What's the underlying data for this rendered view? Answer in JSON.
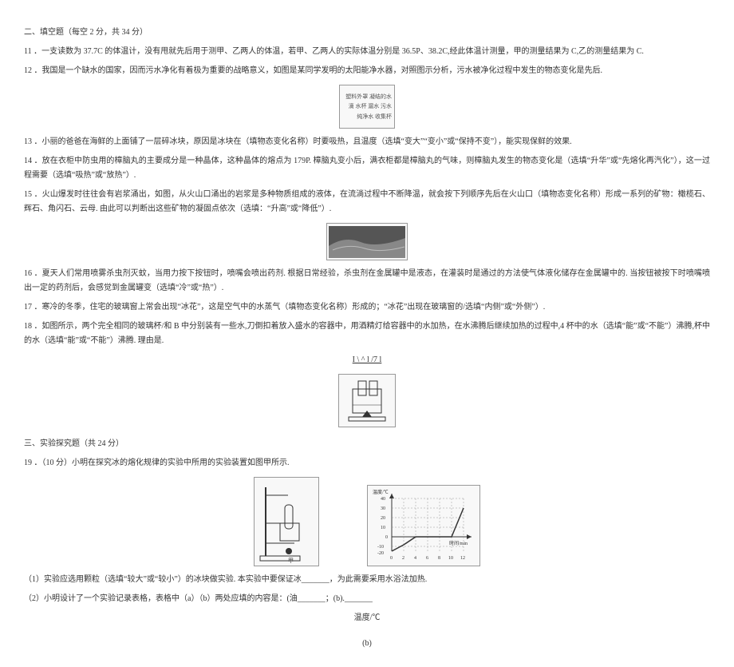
{
  "section2": {
    "header": "二、填空题（每空 2 分，共 34 分）",
    "q11": "11 ．一支读数为 37.7C 的体温计，没有甩就先后用于测甲、乙两人的体温，若甲、乙两人的实际体温分别是 36.5P、38.2C,经此体温计测量，甲的测量结果为 C,乙的测量结果为 C.",
    "q12": "12 ．我国是一个缺水的国家，因而污水净化有着极为重要的战略意义，如图是某同学发明的太阳能净水器，对照图示分析，污水被净化过程中发生的物态变化是先后.",
    "purifier_labels": "塑料外罩\n凝结的水滴\n水杯 漏水\n污水 纯净水\n收集杯",
    "q13": "13 ．小丽的爸爸在海鲜的上面铺了一层碎冰块，原因是冰块在（填物态变化名称）时要吸热，且温度（选填“变大”“变小”或“保持不变”），能实现保鲜的效果.",
    "q14": "14 ．放在衣柜中防虫用的樟脑丸的主要成分是一种晶体，这种晶体的熔点为 179P. 樟脑丸变小后，满衣柜都是樟脑丸的气味，则樟脑丸发生的物态变化是（选填“升华”或“先熔化再汽化”），这一过程需要（选填“吸热”或“放热”）.",
    "q15": "15 ．火山爆发时往往会有岩浆涌出，如图，从火山口涌出的岩浆是多种物质组成的液体，在流淌过程中不断降温，就会按下列顺序先后在火山口（填物态变化名称）形成一系列的矿物：橄榄石、辉石、角闪石、云母. 由此可以判断出这些矿物的凝固点依次（选填：“升高”或“降低”）.",
    "q16": "16 ．夏天人们常用喷雾杀虫剂灭蚊，当用力按下按钮时，喷嘴会喷出药剂. 根据日常经验，杀虫剂在金属罐中是液态，在灌装时是通过的方法使气体液化储存在金属罐中的. 当按钮被按下时喷嘴喷出一定的药剂后，会感觉到金属罐变（选填“冷”或“热”）.",
    "q17": "17 ．寒冷的冬季，住宅的玻璃窗上常会出现“冰花”，这是空气中的水蒸气（填物态变化名称）形成的；“冰花”出现在玻璃窗的/选填“内侧”或“外侧”）.",
    "q18": "18 ．如图所示，两个完全相同的玻璃杯/和 B 中分别装有一些水,刀倒扣着放入盛水的容器中，用酒精灯给容器中的水加热，在水沸腾后继续加热的过程中,4 杯中的水（选填“能”或“不能”）沸腾,杯中的水（选填“能”或“不能”）沸腾. 理由是.",
    "formula": "I \\ ^ l /7 l"
  },
  "section3": {
    "header": "三、实验探究题（共 24 分）",
    "q19_intro": "19 ．（10 分）小明在探究冰的熔化规律的实验中所用的实验装置如图甲所示.",
    "sub1": "（1）实验应选用颗粒（选填“较大”或“较小”）的冰块做实验. 本实验中要保证冰_______，为此需要采用水浴法加热.",
    "sub2": "（2）小明设计了一个实验记录表格，表格中（a）（b）两处应填的内容是：(油_______；(b)._______",
    "table_a": "温度/℃",
    "table_b": "(b)",
    "chart_data": {
      "type": "line",
      "title": "",
      "xlabel": "时间/min",
      "ylabel": "温度/℃",
      "x": [
        0,
        2,
        4,
        6,
        8,
        10,
        12
      ],
      "y": [
        -20,
        -10,
        0,
        0,
        0,
        0,
        30
      ],
      "ylim": [
        -20,
        40
      ],
      "xlim": [
        0,
        12
      ],
      "yticks": [
        -20,
        -10,
        0,
        10,
        20,
        30,
        40
      ],
      "xticks": [
        0,
        2,
        4,
        6,
        8,
        10,
        12
      ]
    }
  }
}
